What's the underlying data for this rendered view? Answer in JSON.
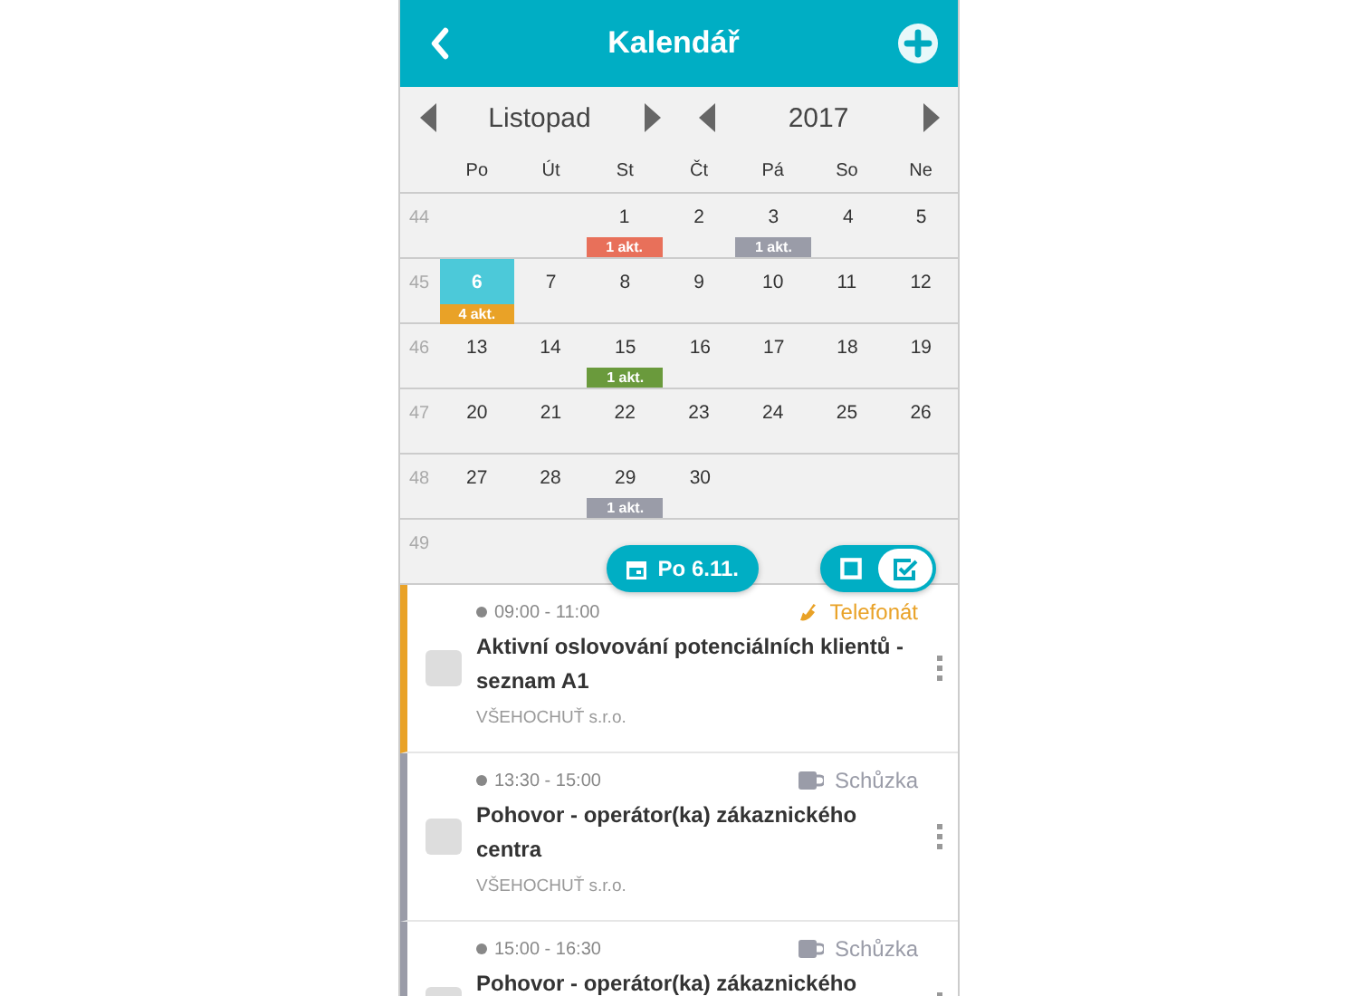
{
  "header": {
    "title": "Kalendář"
  },
  "month_nav": {
    "month": "Listopad",
    "year": "2017"
  },
  "weekdays": [
    "Po",
    "Út",
    "St",
    "Čt",
    "Pá",
    "So",
    "Ne"
  ],
  "weeks": [
    {
      "number": "44",
      "days": [
        {
          "kind": "blank"
        },
        {
          "kind": "blank"
        },
        {
          "kind": "date",
          "day": "1",
          "selected": false,
          "badge": {
            "text": "1 akt.",
            "color": "#e8705a"
          }
        },
        {
          "kind": "date",
          "day": "2",
          "selected": false
        },
        {
          "kind": "date",
          "day": "3",
          "selected": false,
          "badge": {
            "text": "1 akt.",
            "color": "#9a9ca8"
          }
        },
        {
          "kind": "date",
          "day": "4",
          "selected": false
        },
        {
          "kind": "date",
          "day": "5",
          "selected": false
        }
      ]
    },
    {
      "number": "45",
      "days": [
        {
          "kind": "date",
          "day": "6",
          "selected": true,
          "badge": {
            "text": "4 akt.",
            "color": "#e9a227"
          }
        },
        {
          "kind": "date",
          "day": "7",
          "selected": false
        },
        {
          "kind": "date",
          "day": "8",
          "selected": false
        },
        {
          "kind": "date",
          "day": "9",
          "selected": false
        },
        {
          "kind": "date",
          "day": "10",
          "selected": false
        },
        {
          "kind": "date",
          "day": "11",
          "selected": false
        },
        {
          "kind": "date",
          "day": "12",
          "selected": false
        }
      ]
    },
    {
      "number": "46",
      "days": [
        {
          "kind": "date",
          "day": "13",
          "selected": false
        },
        {
          "kind": "date",
          "day": "14",
          "selected": false
        },
        {
          "kind": "date",
          "day": "15",
          "selected": false,
          "badge": {
            "text": "1 akt.",
            "color": "#6a9a3c"
          }
        },
        {
          "kind": "date",
          "day": "16",
          "selected": false
        },
        {
          "kind": "date",
          "day": "17",
          "selected": false
        },
        {
          "kind": "date",
          "day": "18",
          "selected": false
        },
        {
          "kind": "date",
          "day": "19",
          "selected": false
        }
      ]
    },
    {
      "number": "47",
      "days": [
        {
          "kind": "date",
          "day": "20",
          "selected": false
        },
        {
          "kind": "date",
          "day": "21",
          "selected": false
        },
        {
          "kind": "date",
          "day": "22",
          "selected": false
        },
        {
          "kind": "date",
          "day": "23",
          "selected": false
        },
        {
          "kind": "date",
          "day": "24",
          "selected": false
        },
        {
          "kind": "date",
          "day": "25",
          "selected": false
        },
        {
          "kind": "date",
          "day": "26",
          "selected": false
        }
      ]
    },
    {
      "number": "48",
      "days": [
        {
          "kind": "date",
          "day": "27",
          "selected": false
        },
        {
          "kind": "date",
          "day": "28",
          "selected": false
        },
        {
          "kind": "date",
          "day": "29",
          "selected": false,
          "badge": {
            "text": "1 akt.",
            "color": "#9a9ca8"
          }
        },
        {
          "kind": "date",
          "day": "30",
          "selected": false
        },
        {
          "kind": "blank"
        },
        {
          "kind": "blank"
        },
        {
          "kind": "blank"
        }
      ]
    },
    {
      "number": "49",
      "days": [
        {
          "kind": "blank"
        },
        {
          "kind": "blank"
        },
        {
          "kind": "blank"
        },
        {
          "kind": "blank"
        },
        {
          "kind": "blank"
        },
        {
          "kind": "blank"
        },
        {
          "kind": "blank"
        }
      ]
    }
  ],
  "date_button": {
    "label": "Po 6.11."
  },
  "view_toggle": [
    {
      "kind": "square",
      "selected": false
    },
    {
      "kind": "checkbox",
      "selected": true
    }
  ],
  "activities": [
    {
      "kind": "call",
      "color": "#e9a227",
      "time": "09:00 - 11:00",
      "type": "Telefonát",
      "title": "Aktivní oslovování potenciálních klientů - seznam A1",
      "company": "VŠEHOCHUŤ s.r.o.",
      "checked": false
    },
    {
      "kind": "meeting",
      "color": "#9a9ca8",
      "time": "13:30 - 15:00",
      "type": "Schůzka",
      "title": "Pohovor - operátor(ka) zákaznického centra",
      "company": "VŠEHOCHUŤ s.r.o.",
      "checked": false
    },
    {
      "kind": "meeting",
      "color": "#9a9ca8",
      "time": "15:00 - 16:30",
      "type": "Schůzka",
      "title": "Pohovor - operátor(ka) zákaznického",
      "checked": false
    }
  ]
}
